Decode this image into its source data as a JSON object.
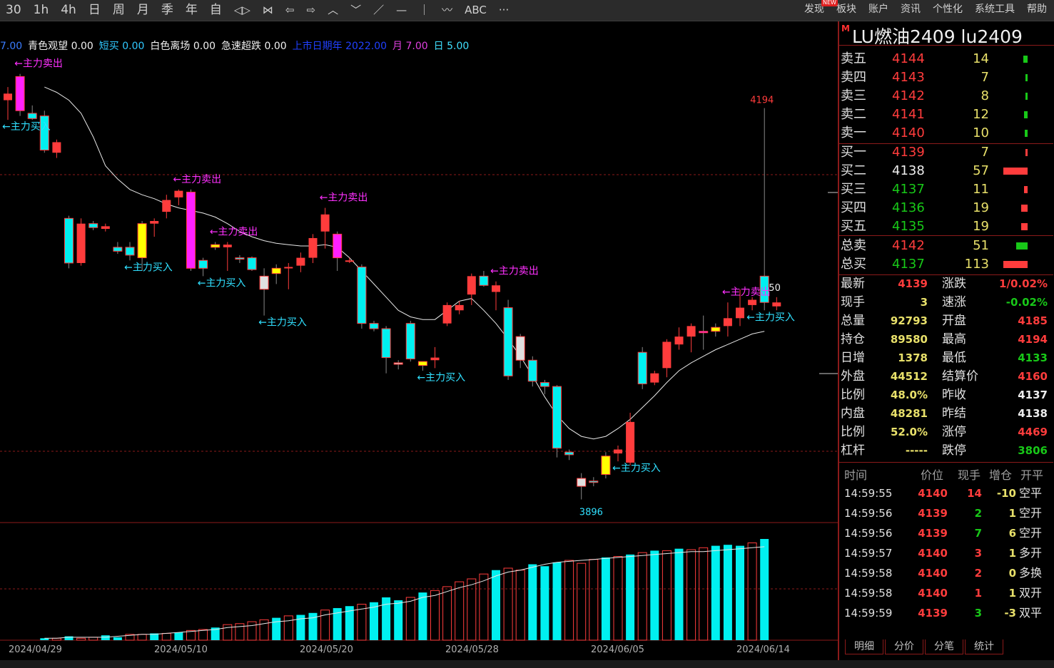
{
  "toolbar": {
    "periods": [
      "30",
      "1h",
      "4h",
      "日",
      "周",
      "月",
      "季",
      "年",
      "自"
    ],
    "tools": [
      "◁▷",
      "⋈",
      "⇦",
      "⇨",
      "︿",
      "﹀",
      "／",
      "—",
      "｜",
      "〰",
      "ABC",
      "···"
    ],
    "menu": [
      "发现",
      "板块",
      "账户",
      "资讯",
      "个性化",
      "系统工具",
      "帮助"
    ],
    "new_badge": "NEW"
  },
  "indicators": [
    {
      "text": "7.00",
      "color": "#3a7cff"
    },
    {
      "text": "青色观望 0.00",
      "color": "#f0f0f0"
    },
    {
      "text": "短买 0.00",
      "color": "#30c8ff"
    },
    {
      "text": "白色离场 0.00",
      "color": "#f0f0f0"
    },
    {
      "text": "急速超跌 0.00",
      "color": "#f0f0f0"
    },
    {
      "text": "上市日期年 2022.00",
      "color": "#2040ff"
    },
    {
      "text": "月 7.00",
      "color": "#e040e0"
    },
    {
      "text": "日 5.00",
      "color": "#40e0ff"
    }
  ],
  "chart_data": {
    "type": "candlestick",
    "instrument": "LU燃油2409",
    "x_labels": [
      "2024/04/29",
      "2024/05/10",
      "2024/05/20",
      "2024/05/28",
      "2024/06/05",
      "2024/06/14"
    ],
    "candles": [
      {
        "o": 4205,
        "h": 4210,
        "l": 4185,
        "c": 4200,
        "color": "up"
      },
      {
        "o": 4218,
        "h": 4220,
        "l": 4188,
        "c": 4192,
        "color": "magenta"
      },
      {
        "o": 4190,
        "h": 4196,
        "l": 4185,
        "c": 4186,
        "color": "cyan"
      },
      {
        "o": 4188,
        "h": 4192,
        "l": 4160,
        "c": 4162,
        "color": "cyan"
      },
      {
        "o": 4168,
        "h": 4170,
        "l": 4156,
        "c": 4160,
        "color": "up"
      },
      {
        "o": 4110,
        "h": 4112,
        "l": 4072,
        "c": 4076,
        "color": "cyan"
      },
      {
        "o": 4076,
        "h": 4110,
        "l": 4074,
        "c": 4106,
        "color": "up"
      },
      {
        "o": 4106,
        "h": 4108,
        "l": 4101,
        "c": 4103,
        "color": "cyan"
      },
      {
        "o": 4104,
        "h": 4106,
        "l": 4100,
        "c": 4102,
        "color": "up"
      },
      {
        "o": 4088,
        "h": 4092,
        "l": 4083,
        "c": 4085,
        "color": "cyan"
      },
      {
        "o": 4088,
        "h": 4092,
        "l": 4078,
        "c": 4082,
        "color": "cyan"
      },
      {
        "o": 4080,
        "h": 4108,
        "l": 4070,
        "c": 4106,
        "color": "yellow"
      },
      {
        "o": 4106,
        "h": 4110,
        "l": 4096,
        "c": 4108,
        "color": "up"
      },
      {
        "o": 4115,
        "h": 4128,
        "l": 4110,
        "c": 4124,
        "color": "up"
      },
      {
        "o": 4126,
        "h": 4132,
        "l": 4120,
        "c": 4131,
        "color": "up"
      },
      {
        "o": 4130,
        "h": 4132,
        "l": 4070,
        "c": 4072,
        "color": "magenta"
      },
      {
        "o": 4078,
        "h": 4080,
        "l": 4066,
        "c": 4072,
        "color": "cyan"
      },
      {
        "o": 4090,
        "h": 4092,
        "l": 4086,
        "c": 4088,
        "color": "yellow"
      },
      {
        "o": 4090,
        "h": 4092,
        "l": 4070,
        "c": 4088,
        "color": "up"
      },
      {
        "o": 4080,
        "h": 4082,
        "l": 4076,
        "c": 4080,
        "color": "cyan"
      },
      {
        "o": 4080,
        "h": 4081,
        "l": 4070,
        "c": 4071,
        "color": "cyan"
      },
      {
        "o": 4066,
        "h": 4072,
        "l": 4036,
        "c": 4056,
        "color": "white"
      },
      {
        "o": 4068,
        "h": 4075,
        "l": 4060,
        "c": 4072,
        "color": "yellow"
      },
      {
        "o": 4072,
        "h": 4076,
        "l": 4056,
        "c": 4073,
        "color": "up"
      },
      {
        "o": 4074,
        "h": 4084,
        "l": 4069,
        "c": 4080,
        "color": "up"
      },
      {
        "o": 4080,
        "h": 4098,
        "l": 4076,
        "c": 4095,
        "color": "up"
      },
      {
        "o": 4113,
        "h": 4118,
        "l": 4087,
        "c": 4100,
        "color": "up"
      },
      {
        "o": 4098,
        "h": 4100,
        "l": 4070,
        "c": 4080,
        "color": "magenta"
      },
      {
        "o": 4078,
        "h": 4080,
        "l": 4076,
        "c": 4078,
        "color": "up"
      },
      {
        "o": 4073,
        "h": 4075,
        "l": 4026,
        "c": 4030,
        "color": "cyan"
      },
      {
        "o": 4030,
        "h": 4032,
        "l": 4024,
        "c": 4026,
        "color": "cyan"
      },
      {
        "o": 4026,
        "h": 4028,
        "l": 3992,
        "c": 4004,
        "color": "cyan"
      },
      {
        "o": 4000,
        "h": 4002,
        "l": 3995,
        "c": 4000,
        "color": "white"
      },
      {
        "o": 4030,
        "h": 4032,
        "l": 4001,
        "c": 4003,
        "color": "cyan"
      },
      {
        "o": 3998,
        "h": 4001,
        "l": 3994,
        "c": 4001,
        "color": "yellow"
      },
      {
        "o": 4002,
        "h": 4012,
        "l": 3996,
        "c": 4004,
        "color": "up"
      },
      {
        "o": 4030,
        "h": 4046,
        "l": 4028,
        "c": 4044,
        "color": "up"
      },
      {
        "o": 4044,
        "h": 4047,
        "l": 4037,
        "c": 4040,
        "color": "up"
      },
      {
        "o": 4052,
        "h": 4068,
        "l": 4044,
        "c": 4066,
        "color": "up"
      },
      {
        "o": 4066,
        "h": 4070,
        "l": 4058,
        "c": 4059,
        "color": "cyan"
      },
      {
        "o": 4059,
        "h": 4062,
        "l": 4040,
        "c": 4054,
        "color": "up"
      },
      {
        "o": 4042,
        "h": 4048,
        "l": 3987,
        "c": 3990,
        "color": "cyan"
      },
      {
        "o": 4020,
        "h": 4022,
        "l": 3996,
        "c": 4002,
        "color": "white"
      },
      {
        "o": 4002,
        "h": 4005,
        "l": 3982,
        "c": 3986,
        "color": "cyan"
      },
      {
        "o": 3985,
        "h": 3987,
        "l": 3976,
        "c": 3982,
        "color": "cyan"
      },
      {
        "o": 3982,
        "h": 3983,
        "l": 3928,
        "c": 3935,
        "color": "cyan"
      },
      {
        "o": 3932,
        "h": 3934,
        "l": 3926,
        "c": 3930,
        "color": "cyan"
      },
      {
        "o": 3912,
        "h": 3916,
        "l": 3896,
        "c": 3906,
        "color": "white"
      },
      {
        "o": 3910,
        "h": 3913,
        "l": 3906,
        "c": 3910,
        "color": "cyan"
      },
      {
        "o": 3915,
        "h": 3932,
        "l": 3912,
        "c": 3929,
        "color": "yellow"
      },
      {
        "o": 3931,
        "h": 3937,
        "l": 3925,
        "c": 3934,
        "color": "up"
      },
      {
        "o": 3924,
        "h": 3962,
        "l": 3922,
        "c": 3955,
        "color": "up"
      },
      {
        "o": 4008,
        "h": 4012,
        "l": 3980,
        "c": 3984,
        "color": "cyan"
      },
      {
        "o": 3985,
        "h": 3994,
        "l": 3983,
        "c": 3992,
        "color": "up"
      },
      {
        "o": 3996,
        "h": 4018,
        "l": 3989,
        "c": 4016,
        "color": "up"
      },
      {
        "o": 4014,
        "h": 4027,
        "l": 4010,
        "c": 4020,
        "color": "up"
      },
      {
        "o": 4020,
        "h": 4030,
        "l": 4008,
        "c": 4028,
        "color": "up"
      },
      {
        "o": 4024,
        "h": 4036,
        "l": 4010,
        "c": 4023,
        "color": "magenta"
      },
      {
        "o": 4024,
        "h": 4030,
        "l": 4020,
        "c": 4027,
        "color": "yellow"
      },
      {
        "o": 4028,
        "h": 4046,
        "l": 4020,
        "c": 4034,
        "color": "up"
      },
      {
        "o": 4034,
        "h": 4056,
        "l": 4028,
        "c": 4042,
        "color": "up"
      },
      {
        "o": 4044,
        "h": 4050,
        "l": 4040,
        "c": 4048,
        "color": "up"
      },
      {
        "o": 4066,
        "h": 4194,
        "l": 4040,
        "c": 4046,
        "color": "cyan"
      },
      {
        "o": 4046,
        "h": 4050,
        "l": 4040,
        "c": 4043,
        "color": "up"
      }
    ],
    "ma_line": [
      4210,
      4206,
      4200,
      4190,
      4172,
      4150,
      4140,
      4132,
      4128,
      4125,
      4121,
      4118,
      4116,
      4114,
      4111,
      4106,
      4100,
      4096,
      4093,
      4091,
      4090,
      4089,
      4089,
      4090,
      4088,
      4080,
      4070,
      4060,
      4050,
      4040,
      4035,
      4033,
      4033,
      4040,
      4047,
      4049,
      4040,
      4030,
      4018,
      4005,
      3990,
      3974,
      3960,
      3950,
      3944,
      3942,
      3944,
      3950,
      3957,
      3966,
      3975,
      3985,
      3994,
      4000,
      4005,
      4010,
      4014,
      4018,
      4022,
      4024
    ],
    "volume": [
      2,
      2,
      4,
      2,
      3,
      5,
      3,
      6,
      6,
      7,
      7,
      8,
      10,
      11,
      13,
      16,
      17,
      19,
      21,
      23,
      25,
      26,
      28,
      31,
      33,
      35,
      37,
      39,
      44,
      41,
      44,
      49,
      51,
      55,
      60,
      63,
      68,
      72,
      74,
      72,
      78,
      76,
      80,
      82,
      79,
      83,
      85,
      86,
      88,
      90,
      92,
      92,
      94,
      93,
      95,
      97,
      98,
      97,
      100,
      104
    ],
    "vol_colors": [
      "c",
      "u",
      "c",
      "u",
      "u",
      "c",
      "c",
      "u",
      "u",
      "c",
      "u",
      "c",
      "u",
      "u",
      "c",
      "u",
      "u",
      "u",
      "u",
      "c",
      "u",
      "c",
      "c",
      "u",
      "c",
      "c",
      "u",
      "c",
      "c",
      "c",
      "u",
      "c",
      "u",
      "u",
      "u",
      "u",
      "u",
      "c",
      "u",
      "u",
      "c",
      "c",
      "c",
      "u",
      "u",
      "u",
      "c",
      "u",
      "c",
      "u",
      "c",
      "u",
      "c",
      "u",
      "u",
      "c",
      "c",
      "c",
      "u",
      "c"
    ],
    "vol_ma": [
      2,
      2,
      3,
      3,
      3,
      3,
      4,
      5,
      6,
      6,
      7,
      8,
      9,
      10,
      11,
      13,
      14,
      15,
      17,
      19,
      20,
      22,
      23,
      26,
      28,
      30,
      32,
      34,
      37,
      38,
      40,
      44,
      46,
      50,
      54,
      57,
      61,
      66,
      70,
      72,
      75,
      78,
      80,
      81,
      82,
      83,
      84,
      85,
      86,
      87,
      88,
      89,
      90,
      91,
      91,
      92,
      93,
      94,
      95,
      96
    ],
    "annotations": [
      {
        "idx": 1,
        "text": "←主力卖出",
        "kind": "sell"
      },
      {
        "idx": 0,
        "text": "←主力买入",
        "kind": "buy"
      },
      {
        "idx": 14,
        "text": "←主力卖出",
        "kind": "sell"
      },
      {
        "idx": 17,
        "text": "←主力卖出",
        "kind": "sell"
      },
      {
        "idx": 10,
        "text": "←主力买入",
        "kind": "buy"
      },
      {
        "idx": 16,
        "text": "←主力买入",
        "kind": "buy"
      },
      {
        "idx": 21,
        "text": "←主力买入",
        "kind": "buy"
      },
      {
        "idx": 26,
        "text": "←主力卖出",
        "kind": "sell"
      },
      {
        "idx": 34,
        "text": "←主力买入",
        "kind": "buy"
      },
      {
        "idx": 40,
        "text": "←主力卖出",
        "kind": "sell"
      },
      {
        "idx": 50,
        "text": "←主力买入",
        "kind": "buy"
      },
      {
        "idx": 59,
        "text": "←主力卖出",
        "kind": "sell"
      },
      {
        "idx": 61,
        "text": "←主力买入",
        "kind": "buy"
      }
    ],
    "high_label": "4194",
    "low_label": "3896",
    "right_mark": "50"
  },
  "quote": {
    "m_mark": "M",
    "title": "LU燃油2409  lu2409",
    "asks": [
      {
        "label": "卖五",
        "price": "4144",
        "vol": "14",
        "bar": 6,
        "pcolor": "up",
        "bcolor": "dn"
      },
      {
        "label": "卖四",
        "price": "4143",
        "vol": "7",
        "bar": 3,
        "pcolor": "up",
        "bcolor": "dn"
      },
      {
        "label": "卖三",
        "price": "4142",
        "vol": "8",
        "bar": 3,
        "pcolor": "up",
        "bcolor": "dn"
      },
      {
        "label": "卖二",
        "price": "4141",
        "vol": "12",
        "bar": 5,
        "pcolor": "up",
        "bcolor": "dn"
      },
      {
        "label": "卖一",
        "price": "4140",
        "vol": "10",
        "bar": 4,
        "pcolor": "up",
        "bcolor": "dn"
      }
    ],
    "bids": [
      {
        "label": "买一",
        "price": "4139",
        "vol": "7",
        "bar": 3,
        "pcolor": "up",
        "bcolor": "up"
      },
      {
        "label": "买二",
        "price": "4138",
        "vol": "57",
        "bar": 34,
        "pcolor": "wh",
        "bcolor": "up"
      },
      {
        "label": "买三",
        "price": "4137",
        "vol": "11",
        "bar": 5,
        "pcolor": "dn",
        "bcolor": "up"
      },
      {
        "label": "买四",
        "price": "4136",
        "vol": "19",
        "bar": 9,
        "pcolor": "dn",
        "bcolor": "up"
      },
      {
        "label": "买五",
        "price": "4135",
        "vol": "19",
        "bar": 9,
        "pcolor": "dn",
        "bcolor": "up"
      }
    ],
    "totals": [
      {
        "label": "总卖",
        "price": "4142",
        "vol": "51",
        "bar": 16,
        "pcolor": "up",
        "bcolor": "dn"
      },
      {
        "label": "总买",
        "price": "4137",
        "vol": "113",
        "bar": 34,
        "pcolor": "dn",
        "bcolor": "up"
      }
    ],
    "stats": [
      {
        "l1": "最新",
        "v1": "4139",
        "c1": "up",
        "l2": "涨跌",
        "v2": "1/0.02%",
        "c2": "up"
      },
      {
        "l1": "现手",
        "v1": "3",
        "c1": "yl",
        "l2": "速涨",
        "v2": "-0.02%",
        "c2": "dn"
      },
      {
        "l1": "总量",
        "v1": "92793",
        "c1": "yl",
        "l2": "开盘",
        "v2": "4185",
        "c2": "up"
      },
      {
        "l1": "持仓",
        "v1": "89580",
        "c1": "yl",
        "l2": "最高",
        "v2": "4194",
        "c2": "up"
      },
      {
        "l1": "日增",
        "v1": "1378",
        "c1": "yl",
        "l2": "最低",
        "v2": "4133",
        "c2": "dn"
      },
      {
        "l1": "外盘",
        "v1": "44512",
        "c1": "yl",
        "l2": "结算价",
        "v2": "4160",
        "c2": "up"
      },
      {
        "l1": "比例",
        "v1": "48.0%",
        "c1": "yl",
        "l2": "昨收",
        "v2": "4137",
        "c2": "wh"
      },
      {
        "l1": "内盘",
        "v1": "48281",
        "c1": "yl",
        "l2": "昨结",
        "v2": "4138",
        "c2": "wh"
      },
      {
        "l1": "比例",
        "v1": "52.0%",
        "c1": "yl",
        "l2": "涨停",
        "v2": "4469",
        "c2": "up"
      },
      {
        "l1": "杠杆",
        "v1": "-----",
        "c1": "yl",
        "l2": "跌停",
        "v2": "3806",
        "c2": "dn"
      }
    ],
    "trade_header": {
      "time": "时间",
      "price": "价位",
      "vol": "现手",
      "chg": "增仓",
      "type": "开平"
    },
    "trades": [
      {
        "time": "14:59:55",
        "price": "4140",
        "vol": "14",
        "chg": "-10",
        "type": "空平",
        "vcolor": "up"
      },
      {
        "time": "14:59:56",
        "price": "4139",
        "vol": "2",
        "chg": "1",
        "type": "空开",
        "vcolor": "dn"
      },
      {
        "time": "14:59:56",
        "price": "4139",
        "vol": "7",
        "chg": "6",
        "type": "空开",
        "vcolor": "dn"
      },
      {
        "time": "14:59:57",
        "price": "4140",
        "vol": "3",
        "chg": "1",
        "type": "多开",
        "vcolor": "up"
      },
      {
        "time": "14:59:58",
        "price": "4140",
        "vol": "2",
        "chg": "0",
        "type": "多换",
        "vcolor": "up"
      },
      {
        "time": "14:59:58",
        "price": "4140",
        "vol": "1",
        "chg": "1",
        "type": "双开",
        "vcolor": "up"
      },
      {
        "time": "14:59:59",
        "price": "4139",
        "vol": "3",
        "chg": "-3",
        "type": "双平",
        "vcolor": "dn"
      }
    ],
    "tabs": [
      "明细",
      "分价",
      "分笔",
      "统计"
    ]
  },
  "colors": {
    "up": "#ff3c3c",
    "down": "#18c818",
    "cyan": "#00f0f0",
    "magenta": "#ff20ff",
    "yellow": "#ffff00",
    "grid": "#8b1a1a"
  }
}
